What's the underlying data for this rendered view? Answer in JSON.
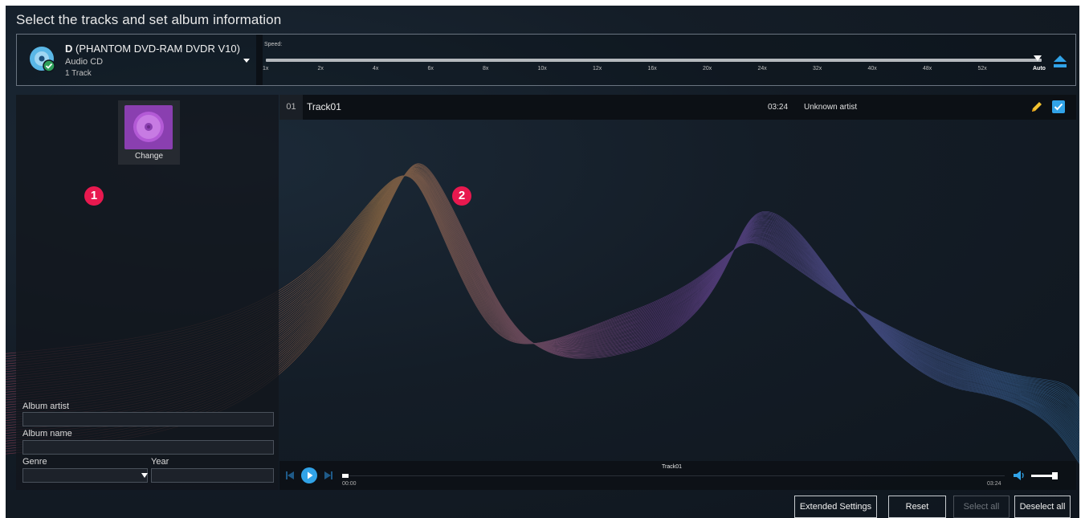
{
  "window": {
    "title": "Select the tracks and set album information"
  },
  "drive": {
    "letter": "D",
    "model": "(PHANTOM DVD-RAM DVDR V10)",
    "type": "Audio CD",
    "tracks": "1 Track",
    "icon": "disc-check-icon"
  },
  "speed": {
    "label": "Speed:",
    "options": [
      "1x",
      "2x",
      "4x",
      "6x",
      "8x",
      "10x",
      "12x",
      "16x",
      "20x",
      "24x",
      "32x",
      "40x",
      "48x",
      "52x",
      "Auto"
    ],
    "selected": "Auto"
  },
  "album": {
    "cover_button_label": "Change",
    "artist_label": "Album artist",
    "artist_value": "",
    "name_label": "Album name",
    "name_value": "",
    "genre_label": "Genre",
    "genre_value": "",
    "year_label": "Year",
    "year_value": ""
  },
  "tracks": [
    {
      "number": "01",
      "title": "Track01",
      "duration": "03:24",
      "artist": "Unknown artist",
      "checked": true
    }
  ],
  "annotations": [
    "1",
    "2"
  ],
  "player": {
    "track_title": "Track01",
    "current_time": "00:00",
    "total_time": "03:24",
    "position": 0,
    "volume": 0.85
  },
  "buttons": {
    "extended_settings": "Extended Settings",
    "reset": "Reset",
    "select_all": "Select all",
    "deselect_all": "Deselect all"
  },
  "colors": {
    "accent": "#31a3e8",
    "badge": "#e8194f",
    "cover": "#8a3fb0",
    "pencil": "#f2c230"
  }
}
